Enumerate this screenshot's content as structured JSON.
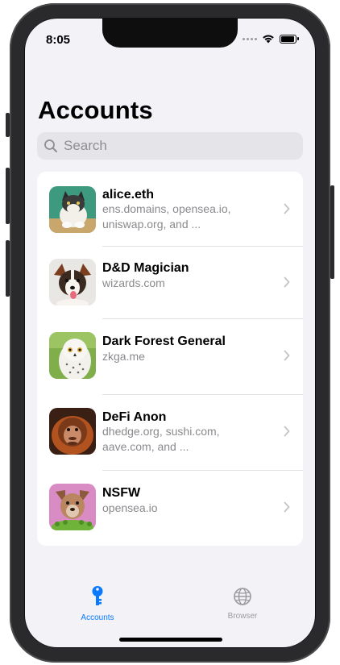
{
  "status_bar": {
    "time": "8:05"
  },
  "header": {
    "title": "Accounts"
  },
  "search": {
    "placeholder": "Search"
  },
  "accounts": [
    {
      "name": "alice.eth",
      "sites": "ens.domains, opensea.io, uniswap.org, and ...",
      "avatar": "cat"
    },
    {
      "name": "D&D Magician",
      "sites": "wizards.com",
      "avatar": "dog"
    },
    {
      "name": "Dark Forest General",
      "sites": "zkga.me",
      "avatar": "owl"
    },
    {
      "name": "DeFi Anon",
      "sites": "dhedge.org, sushi.com, aave.com, and ...",
      "avatar": "orangutan"
    },
    {
      "name": "NSFW",
      "sites": "opensea.io",
      "avatar": "dog-pink"
    }
  ],
  "tabbar": {
    "accounts_label": "Accounts",
    "browser_label": "Browser",
    "active": "accounts"
  },
  "colors": {
    "accent": "#0a7aff",
    "inactive": "#9a9aa0",
    "background": "#f2f2f7"
  },
  "icons": {
    "accounts_tab": "key-icon",
    "browser_tab": "globe-icon",
    "search": "magnifier-icon",
    "disclosure": "chevron-right-icon"
  }
}
